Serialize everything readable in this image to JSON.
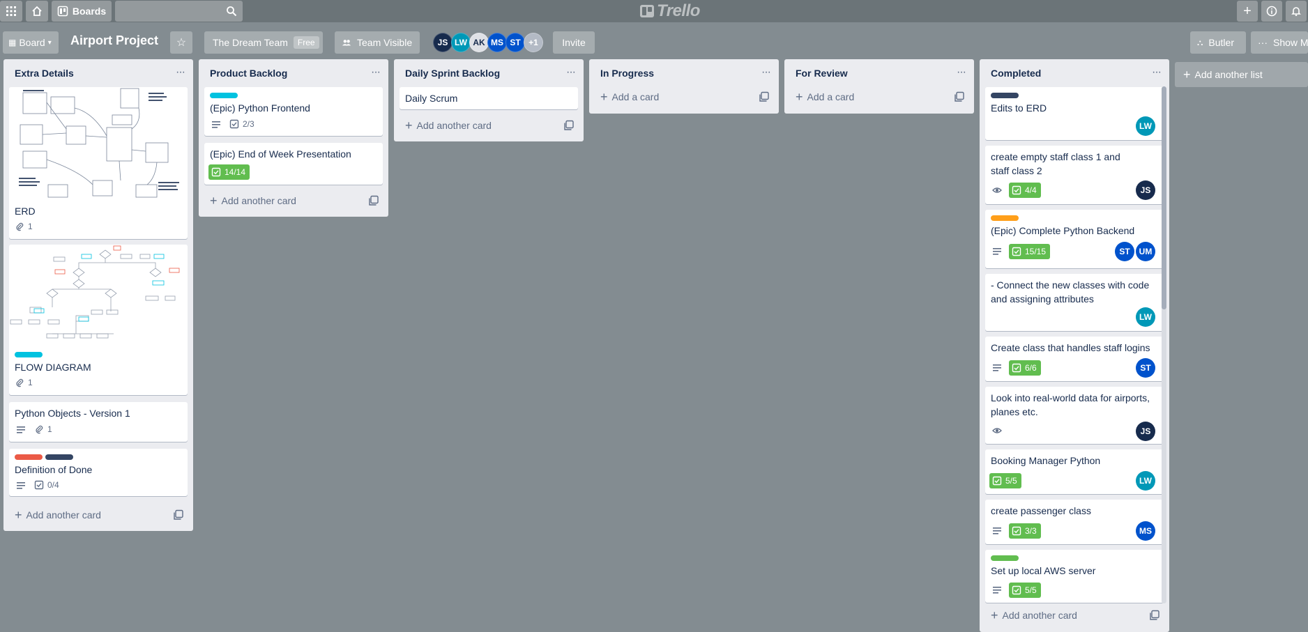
{
  "header": {
    "boards_label": "Boards",
    "logo_text": "Trello"
  },
  "board": {
    "view_label": "Board",
    "title": "Airport Project",
    "team_name": "The Dream Team",
    "team_plan": "Free",
    "visibility": "Team Visible",
    "invite_label": "Invite",
    "butler_label": "Butler",
    "show_menu_label": "Show Me",
    "add_list_label": "Add another list",
    "members": [
      {
        "initials": "JS",
        "color": "#172b4d"
      },
      {
        "initials": "LW",
        "color": "#0098b7"
      },
      {
        "initials": "AK",
        "color": "#dfe1e6"
      },
      {
        "initials": "MS",
        "color": "#0052cc"
      },
      {
        "initials": "ST",
        "color": "#0052cc"
      },
      {
        "initials": "+1",
        "color": "#b3bac5"
      }
    ]
  },
  "lists": [
    {
      "title": "Extra Details",
      "cards": [
        {
          "title": "ERD",
          "attachments": "1"
        },
        {
          "title": "FLOW DIAGRAM",
          "attachments": "1",
          "label_color": "#00c2e0"
        },
        {
          "title": "Python Objects - Version 1",
          "attachments": "1"
        },
        {
          "title": "Definition of Done",
          "checklist": "0/4",
          "label_colors": [
            "#eb5a46",
            "#344563"
          ]
        }
      ],
      "add_label": "Add another card"
    },
    {
      "title": "Product Backlog",
      "cards": [
        {
          "title": "(Epic) Python Frontend",
          "checklist": "2/3",
          "label_color": "#00c2e0"
        },
        {
          "title": "(Epic) End of Week Presentation",
          "checklist": "14/14"
        }
      ],
      "add_label": "Add another card"
    },
    {
      "title": "Daily Sprint Backlog",
      "cards": [
        {
          "title": "Daily Scrum"
        }
      ],
      "add_label": "Add another card"
    },
    {
      "title": "In Progress",
      "add_label": "Add a card"
    },
    {
      "title": "For Review",
      "add_label": "Add a card"
    },
    {
      "title": "Completed",
      "cards": [
        {
          "title": "Edits to ERD",
          "label_color": "#344563",
          "members": [
            "LW"
          ]
        },
        {
          "title": "create empty staff class 1 and staff class 2",
          "checklist": "4/4",
          "members": [
            "JS"
          ]
        },
        {
          "title": "(Epic) Complete Python Backend",
          "checklist": "15/15",
          "label_color": "#ff9f1a",
          "members": [
            "ST",
            "UM"
          ]
        },
        {
          "title": "- Connect the new classes with code and assigning attributes",
          "members": [
            "LW"
          ]
        },
        {
          "title": "Create class that handles staff logins",
          "checklist": "6/6",
          "members": [
            "ST"
          ]
        },
        {
          "title": "Look into real-world data for airports, planes etc.",
          "members": [
            "JS"
          ]
        },
        {
          "title": "Booking Manager Python",
          "checklist": "5/5",
          "members": [
            "LW"
          ]
        },
        {
          "title": "create passenger class",
          "checklist": "3/3",
          "members": [
            "MS"
          ]
        },
        {
          "title": "Set up local AWS server",
          "checklist": "5/5",
          "label_color": "#61bd4f"
        }
      ],
      "add_label": "Add another card"
    }
  ],
  "colors": {
    "member_JS": "#172b4d",
    "member_LW": "#0098b7",
    "member_ST": "#0052cc",
    "member_UM": "#0052cc",
    "member_MS": "#0052cc"
  }
}
